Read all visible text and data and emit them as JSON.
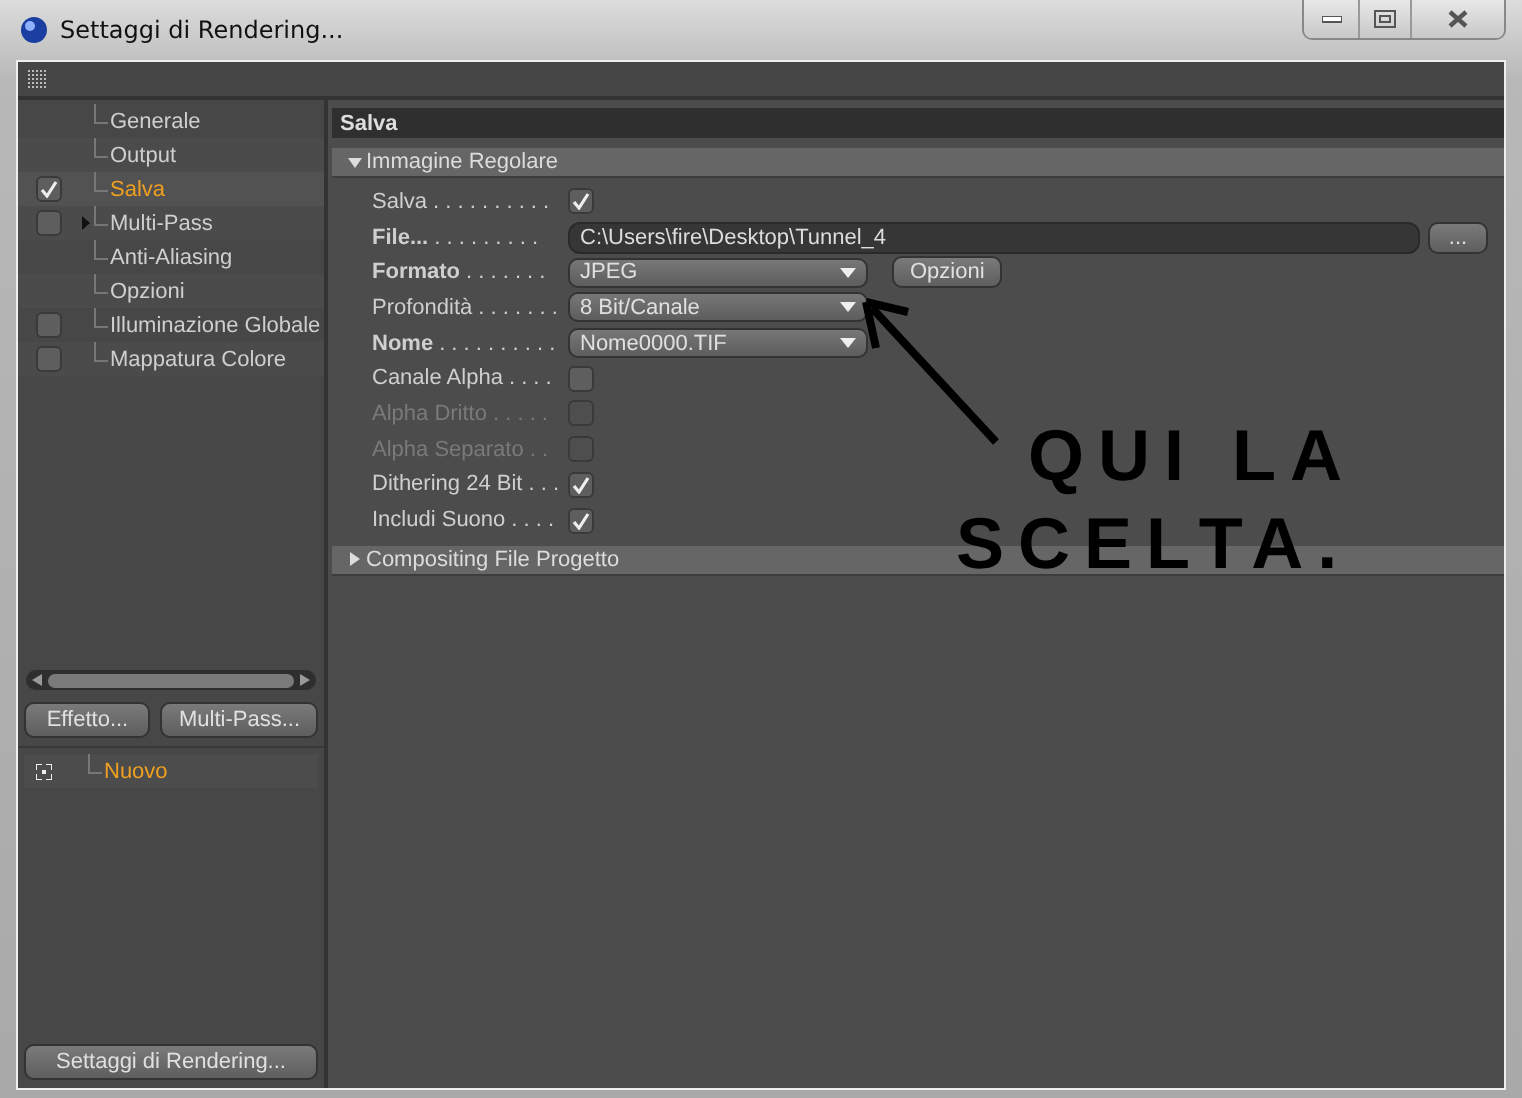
{
  "window": {
    "title": "Settaggi di Rendering..."
  },
  "sidebar": {
    "items": [
      {
        "label": "Generale",
        "selected": false,
        "expandable": false
      },
      {
        "label": "Output",
        "selected": false,
        "expandable": false
      },
      {
        "label": "Salva",
        "checked": true,
        "selected": true,
        "expandable": false
      },
      {
        "label": "Multi-Pass",
        "checked": false,
        "selected": false,
        "expandable": true
      },
      {
        "label": "Anti-Aliasing",
        "selected": false,
        "expandable": false
      },
      {
        "label": "Opzioni",
        "selected": false,
        "expandable": false
      },
      {
        "label": "Illuminazione Globale",
        "checked": false,
        "selected": false,
        "expandable": false
      },
      {
        "label": "Mappatura Colore",
        "checked": false,
        "selected": false,
        "expandable": false
      }
    ],
    "buttons": [
      "Effetto...",
      "Multi-Pass..."
    ],
    "effects": [
      {
        "label": "Nuovo",
        "selected": true
      }
    ],
    "footer_button": "Settaggi di Rendering..."
  },
  "panel": {
    "title": "Salva",
    "sections": [
      {
        "title": "Immagine Regolare",
        "expanded": true,
        "rows": [
          {
            "kind": "checkbox",
            "label": "Salva",
            "leader": ". . . . . . . . . .",
            "bold": false,
            "disabled": false,
            "checked": true
          },
          {
            "kind": "path",
            "label": "File...",
            "leader": ". . . . . . . . .",
            "bold": true,
            "disabled": false,
            "value": "C:\\Users\\fire\\Desktop\\Tunnel_4",
            "button": "..."
          },
          {
            "kind": "dropdown",
            "label": "Formato",
            "leader": ". . . . . . .",
            "bold": true,
            "disabled": false,
            "value": "JPEG",
            "button": "Opzioni"
          },
          {
            "kind": "dropdown",
            "label": "Profondità",
            "leader": ". . . . . . .",
            "bold": false,
            "disabled": false,
            "value": "8 Bit/Canale"
          },
          {
            "kind": "dropdown",
            "label": "Nome",
            "leader": ". . . . . . . . . .",
            "bold": true,
            "disabled": false,
            "value": "Nome0000.TIF"
          },
          {
            "kind": "checkbox",
            "label": "Canale Alpha",
            "leader": ". . . .",
            "bold": false,
            "disabled": false,
            "checked": false
          },
          {
            "kind": "checkbox",
            "label": "Alpha Dritto",
            "leader": ". . . . .",
            "bold": false,
            "disabled": true,
            "checked": false
          },
          {
            "kind": "checkbox",
            "label": "Alpha Separato",
            "leader": ". .",
            "bold": false,
            "disabled": true,
            "checked": false
          },
          {
            "kind": "checkbox",
            "label": "Dithering 24 Bit",
            "leader": ". . .",
            "bold": false,
            "disabled": false,
            "checked": true
          },
          {
            "kind": "checkbox",
            "label": "Includi Suono",
            "leader": ". . . .",
            "bold": false,
            "disabled": false,
            "checked": true
          }
        ]
      },
      {
        "title": "Compositing File Progetto",
        "expanded": false
      }
    ]
  },
  "annotation": {
    "text": "QUI LA SCELTA."
  }
}
